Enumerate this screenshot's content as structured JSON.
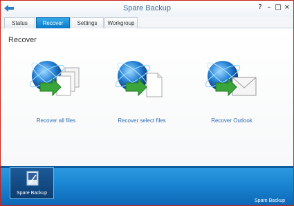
{
  "window": {
    "title": "Spare Backup"
  },
  "controls": {
    "help": "?",
    "minimize": "–",
    "maximize": "□",
    "close": "×"
  },
  "tabs": [
    {
      "label": "Status"
    },
    {
      "label": "Recover",
      "active": true
    },
    {
      "label": "Settings"
    },
    {
      "label": "Workgroup"
    }
  ],
  "main": {
    "title": "Recover",
    "options": [
      {
        "label": "Recover all files",
        "icon": "globe-multiple-files-icon"
      },
      {
        "label": "Recover select files",
        "icon": "globe-file-icon"
      },
      {
        "label": "Recover Outlook",
        "icon": "globe-envelope-icon"
      }
    ]
  },
  "bottom": {
    "app_tile_label": "Spare Backup",
    "brand": "Spare Backup"
  },
  "colors": {
    "accent": "#0a79c9",
    "border": "#c8221a",
    "link": "#2a6db0"
  }
}
